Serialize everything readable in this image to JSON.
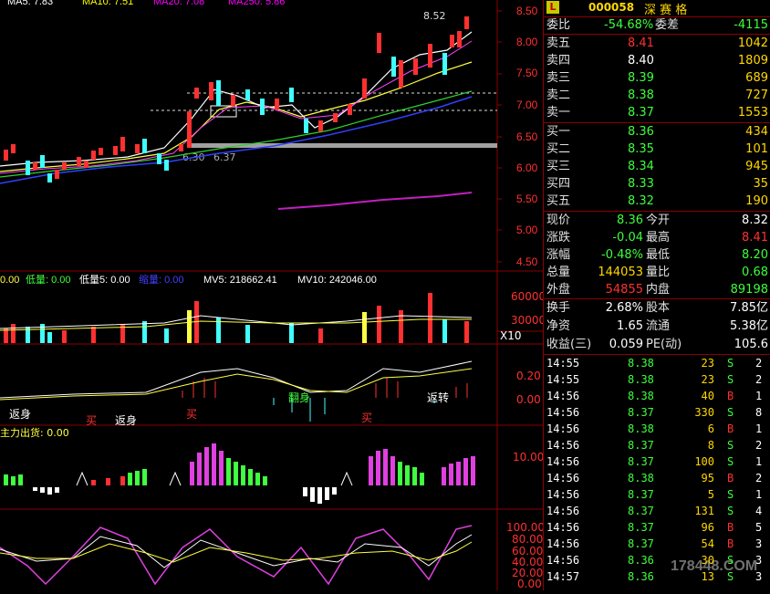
{
  "chart": {
    "price_axis": [
      "8.50",
      "8.00",
      "7.50",
      "7.00",
      "6.50",
      "6.00",
      "5.50",
      "5.00",
      "4.50"
    ],
    "high_label": "8.52",
    "low_labels": [
      "6.30",
      "6.37"
    ],
    "ma_header": [
      "MA5: 7.83",
      "MA10: 7.51",
      "MA20: 7.08",
      "MA250: 5.86"
    ],
    "vol_header": {
      "a": "0.00",
      "b_label": "低量: 0.00",
      "c_label": "低量5: 0.00",
      "d_label": "缩量: 0.00",
      "mv5": "MV5: 218662.41",
      "mv10": "MV10: 242046.00"
    },
    "vol_axis": [
      "60000",
      "30000"
    ],
    "vol_unit": "X10",
    "macd_axis": [
      "0.20",
      "0.00"
    ],
    "macd_labels": [
      "返身",
      "买",
      "返身",
      "买",
      "翻身",
      "买",
      "返转"
    ],
    "chip_header": "主力出货: 0.00",
    "chip_axis": [
      "10.00"
    ],
    "kdj_axis": [
      "100.00",
      "80.00",
      "60.00",
      "40.00",
      "20.00",
      "0.00"
    ],
    "watermark": "178448.COM"
  },
  "panel": {
    "logo": "L",
    "code": "000058",
    "name": "深 赛 格",
    "weibi": {
      "label": "委比",
      "value": "-54.68%",
      "label2": "委差",
      "value2": "-4115"
    },
    "asks": [
      {
        "label": "卖五",
        "price": "8.41",
        "vol": "1042"
      },
      {
        "label": "卖四",
        "price": "8.40",
        "vol": "1809"
      },
      {
        "label": "卖三",
        "price": "8.39",
        "vol": "689"
      },
      {
        "label": "卖二",
        "price": "8.38",
        "vol": "727"
      },
      {
        "label": "卖一",
        "price": "8.37",
        "vol": "1553"
      }
    ],
    "bids": [
      {
        "label": "买一",
        "price": "8.36",
        "vol": "434"
      },
      {
        "label": "买二",
        "price": "8.35",
        "vol": "101"
      },
      {
        "label": "买三",
        "price": "8.34",
        "vol": "945"
      },
      {
        "label": "买四",
        "price": "8.33",
        "vol": "35"
      },
      {
        "label": "买五",
        "price": "8.32",
        "vol": "190"
      }
    ],
    "stats": [
      {
        "l1": "现价",
        "v1": "8.36",
        "l2": "今开",
        "v2": "8.32"
      },
      {
        "l1": "涨跌",
        "v1": "-0.04",
        "l2": "最高",
        "v2": "8.41"
      },
      {
        "l1": "涨幅",
        "v1": "-0.48%",
        "l2": "最低",
        "v2": "8.20"
      },
      {
        "l1": "总量",
        "v1": "144053",
        "l2": "量比",
        "v2": "0.68"
      },
      {
        "l1": "外盘",
        "v1": "54855",
        "l2": "内盘",
        "v2": "89198"
      }
    ],
    "stats2": [
      {
        "l1": "换手",
        "v1": "2.68%",
        "l2": "股本",
        "v2": "7.85亿"
      },
      {
        "l1": "净资",
        "v1": "1.65",
        "l2": "流通",
        "v2": "5.38亿"
      },
      {
        "l1": "收益(三)",
        "v1": "0.059",
        "l2": "PE(动)",
        "v2": "105.6"
      }
    ],
    "trades": [
      {
        "t": "14:55",
        "p": "8.38",
        "v": "23",
        "s": "S",
        "n": "2"
      },
      {
        "t": "14:55",
        "p": "8.38",
        "v": "23",
        "s": "S",
        "n": "2"
      },
      {
        "t": "14:56",
        "p": "8.38",
        "v": "40",
        "s": "B",
        "n": "1"
      },
      {
        "t": "14:56",
        "p": "8.37",
        "v": "330",
        "s": "S",
        "n": "8"
      },
      {
        "t": "14:56",
        "p": "8.38",
        "v": "6",
        "s": "B",
        "n": "1"
      },
      {
        "t": "14:56",
        "p": "8.37",
        "v": "8",
        "s": "S",
        "n": "2"
      },
      {
        "t": "14:56",
        "p": "8.37",
        "v": "100",
        "s": "S",
        "n": "1"
      },
      {
        "t": "14:56",
        "p": "8.38",
        "v": "95",
        "s": "B",
        "n": "2"
      },
      {
        "t": "14:56",
        "p": "8.37",
        "v": "5",
        "s": "S",
        "n": "1"
      },
      {
        "t": "14:56",
        "p": "8.37",
        "v": "131",
        "s": "S",
        "n": "4"
      },
      {
        "t": "14:56",
        "p": "8.37",
        "v": "96",
        "s": "B",
        "n": "5"
      },
      {
        "t": "14:56",
        "p": "8.37",
        "v": "54",
        "s": "B",
        "n": "3"
      },
      {
        "t": "14:56",
        "p": "8.36",
        "v": "30",
        "s": "S",
        "n": "3"
      },
      {
        "t": "14:57",
        "p": "8.36",
        "v": "13",
        "s": "S",
        "n": "3"
      }
    ]
  },
  "colors": {
    "up": "#ff3030",
    "down": "#3cff3c",
    "line": "#8b0000"
  }
}
